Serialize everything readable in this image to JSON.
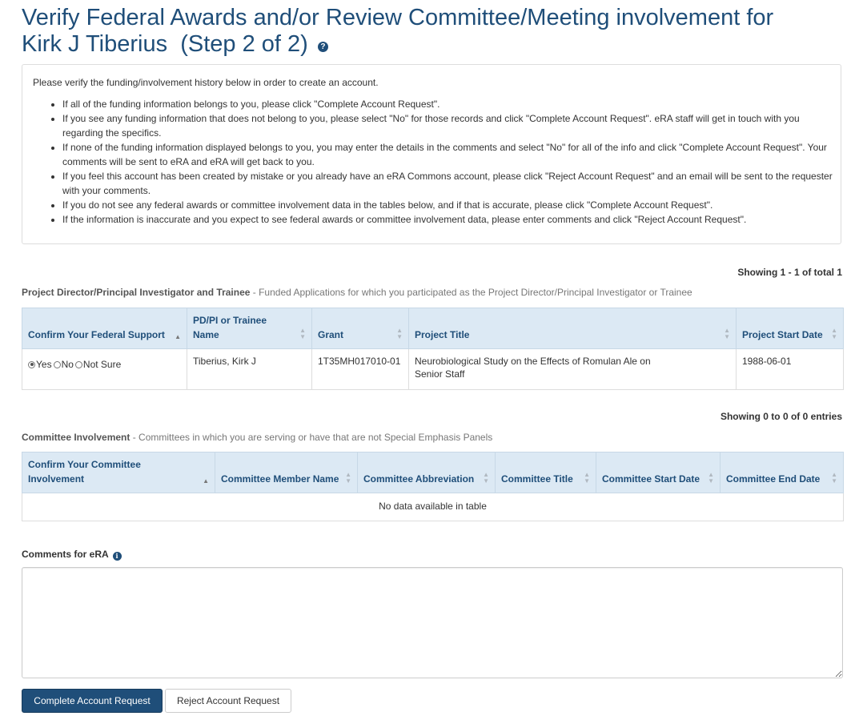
{
  "header": {
    "title_line1": "Verify Federal Awards and/or Review Committee/Meeting involvement for",
    "title_name": "Kirk J Tiberius",
    "title_step": "(Step 2 of 2)",
    "help_icon_glyph": "?"
  },
  "info": {
    "intro": "Please verify the funding/involvement history below in order to create an account.",
    "items": [
      "If all of the funding information belongs to you, please click \"Complete Account Request\".",
      "If you see any funding information that does not belong to you, please select \"No\" for those records and click \"Complete Account Request\". eRA staff will get in touch with you regarding the specifics.",
      "If none of the funding information displayed belongs to you, you may enter the details in the comments and select \"No\" for all of the info and click \"Complete Account Request\". Your comments will be sent to eRA and eRA will get back to you.",
      "If you feel this account has been created by mistake or you already have an eRA Commons account, please click \"Reject Account Request\" and an email will be sent to the requester with your comments.",
      "If you do not see any federal awards or committee involvement data in the tables below, and if that is accurate, please click \"Complete Account Request\".",
      "If the information is inaccurate and you expect to see federal awards or committee involvement data, please enter comments and click \"Reject Account Request\"."
    ]
  },
  "pdpi": {
    "showing": "Showing 1 - 1 of total 1",
    "caption_bold": "Project Director/Principal Investigator and Trainee",
    "caption_rest": " - Funded Applications for which you participated as the Project Director/Principal Investigator or Trainee",
    "columns": [
      "Confirm Your Federal Support",
      "PD/PI or Trainee Name",
      "Grant",
      "Project Title",
      "Project Start Date"
    ],
    "rows": [
      {
        "confirm_options": [
          "Yes",
          "No",
          "Not Sure"
        ],
        "confirm_selected": "Yes",
        "name": "Tiberius, Kirk J",
        "grant": "1T35MH017010-01",
        "title": "Neurobiological Study on the Effects of Romulan Ale on Senior Staff",
        "start_date": "1988-06-01"
      }
    ]
  },
  "committee": {
    "showing": "Showing 0 to 0 of 0 entries",
    "caption_bold": "Committee Involvement",
    "caption_rest": " - Committees in which you are serving or have that are not Special Emphasis Panels",
    "columns": [
      "Confirm Your Committee Involvement",
      "Committee Member Name",
      "Committee Abbreviation",
      "Committee Title",
      "Committee Start Date",
      "Committee End Date"
    ],
    "empty_text": "No data available in table"
  },
  "comments": {
    "label": "Comments for eRA",
    "info_icon_glyph": "i",
    "value": ""
  },
  "actions": {
    "complete_label": "Complete Account Request",
    "reject_label": "Reject Account Request"
  },
  "colors": {
    "brand": "#1f4e79",
    "header_bg": "#dce9f4"
  }
}
